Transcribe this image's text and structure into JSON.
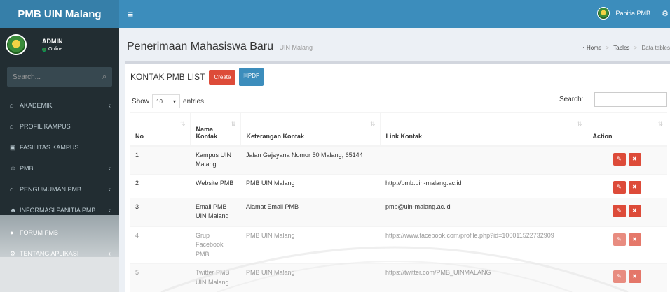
{
  "app": {
    "logo": "PMB UIN Malang"
  },
  "user_panel": {
    "name": "ADMIN",
    "status": "Online"
  },
  "sidebar": {
    "search_placeholder": "Search...",
    "items": [
      {
        "label": "AKADEMIK",
        "icon": "bank-icon",
        "has_submenu": true
      },
      {
        "label": "PROFIL KAMPUS",
        "icon": "home-icon",
        "has_submenu": false
      },
      {
        "label": "FASILITAS KAMPUS",
        "icon": "building-icon",
        "has_submenu": false
      },
      {
        "label": "PMB",
        "icon": "users-icon",
        "has_submenu": true
      },
      {
        "label": "PENGUMUMAN PMB",
        "icon": "bank-icon",
        "has_submenu": true
      },
      {
        "label": "INFORMASI PANITIA PMB",
        "icon": "user-group-icon",
        "has_submenu": true
      },
      {
        "label": "FORUM PMB",
        "icon": "comments-icon",
        "has_submenu": false
      },
      {
        "label": "TENTANG APLIKASI",
        "icon": "gear-icon",
        "has_submenu": true
      }
    ]
  },
  "topbar": {
    "user": "Panitia PMB"
  },
  "header": {
    "title": "Penerimaan Mahasiswa Baru",
    "subtitle": "UIN Malang",
    "breadcrumb": [
      "Home",
      "Tables",
      "Data tables"
    ]
  },
  "box": {
    "title": "KONTAK PMB LIST",
    "create_label": "Create",
    "pdf_label": "PDF",
    "show_label": "Show",
    "entries_value": "10",
    "entries_label": "entries",
    "search_label": "Search:"
  },
  "table": {
    "columns": [
      "No",
      "Nama Kontak",
      "Keterangan Kontak",
      "Link Kontak",
      "Action"
    ],
    "rows": [
      {
        "no": "1",
        "nama": "Kampus UIN Malang",
        "keterangan": "Jalan Gajayana Nomor 50 Malang, 65144",
        "link": ""
      },
      {
        "no": "2",
        "nama": "Website PMB",
        "keterangan": "PMB UIN Malang",
        "link": "http://pmb.uin-malang.ac.id"
      },
      {
        "no": "3",
        "nama": "Email PMB UIN Malang",
        "keterangan": "Alamat Email PMB",
        "link": "pmb@uin-malang.ac.id"
      },
      {
        "no": "4",
        "nama": "Grup Facebook PMB",
        "keterangan": "PMB UIN Malang",
        "link": "https://www.facebook.com/profile.php?id=100011522732909"
      },
      {
        "no": "5",
        "nama": "Twitter PMB UIN Malang",
        "keterangan": "PMB UIN Malang",
        "link": "https://twitter.com/PMB_UINMALANG"
      }
    ]
  },
  "colors": {
    "topbar": "#3c8dbc",
    "logo": "#367fa9",
    "sidebar": "#222d32",
    "danger": "#dd4b39"
  }
}
